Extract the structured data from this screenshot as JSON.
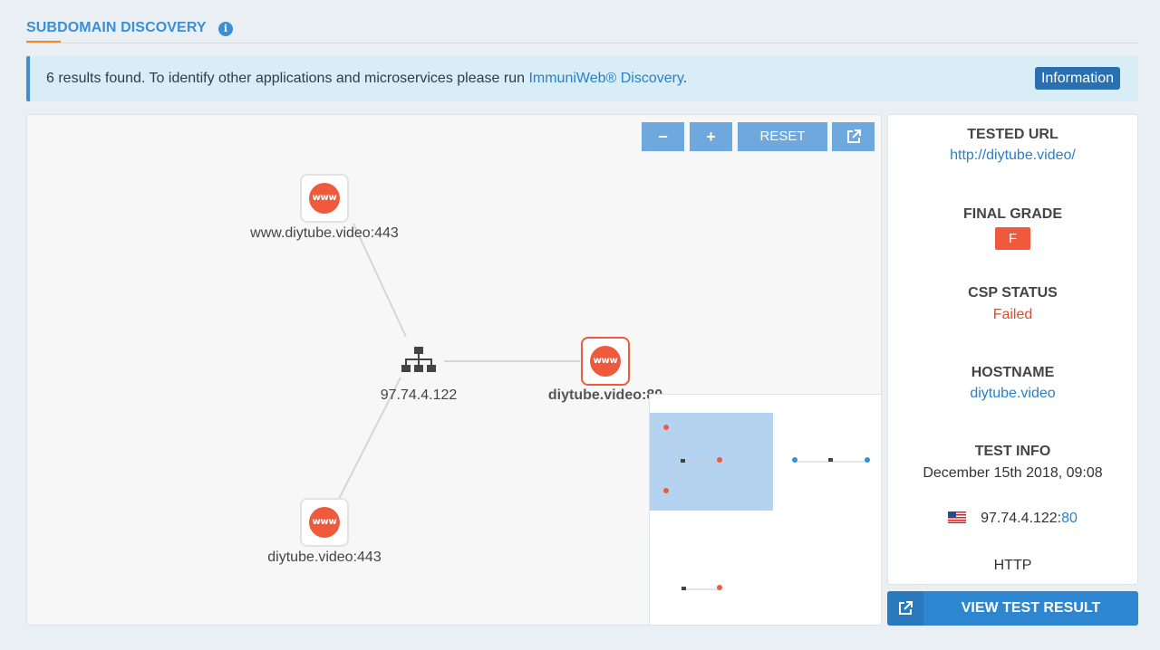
{
  "section": {
    "title": "SUBDOMAIN DISCOVERY",
    "info_icon": "info-icon"
  },
  "alert": {
    "text": "6 results found. To identify other applications and microservices please run ",
    "link": "ImmuniWeb® Discovery",
    "suffix": ".",
    "badge": "Information"
  },
  "graph": {
    "controls": {
      "zoom_out": "−",
      "zoom_in": "+",
      "reset": "RESET",
      "external_icon": "external-link-icon"
    },
    "nodes": [
      {
        "label": "www.diytube.video:443",
        "icon": "www-icon",
        "text": "www"
      },
      {
        "label": "97.74.4.122",
        "icon": "network-icon"
      },
      {
        "label": "diytube.video:80",
        "icon": "www-icon",
        "text": "www",
        "active": true
      },
      {
        "label": "diytube.video:443",
        "icon": "www-icon",
        "text": "www"
      }
    ]
  },
  "details": {
    "tested_url_label": "TESTED URL",
    "tested_url": "http://diytube.video/",
    "final_grade_label": "FINAL GRADE",
    "final_grade": "F",
    "csp_status_label": "CSP STATUS",
    "csp_status": "Failed",
    "hostname_label": "HOSTNAME",
    "hostname": "diytube.video",
    "test_info_label": "TEST INFO",
    "test_date": "December 15th 2018, 09:08",
    "ip": "97.74.4.122:",
    "port": "80",
    "protocol": "HTTP",
    "flag_icon": "us-flag-icon"
  },
  "view_button": {
    "label": "VIEW TEST RESULT",
    "icon": "external-link-icon"
  },
  "colors": {
    "accent": "#3a8fd6",
    "danger": "#ef5a3c",
    "button": "#2e85d0"
  }
}
